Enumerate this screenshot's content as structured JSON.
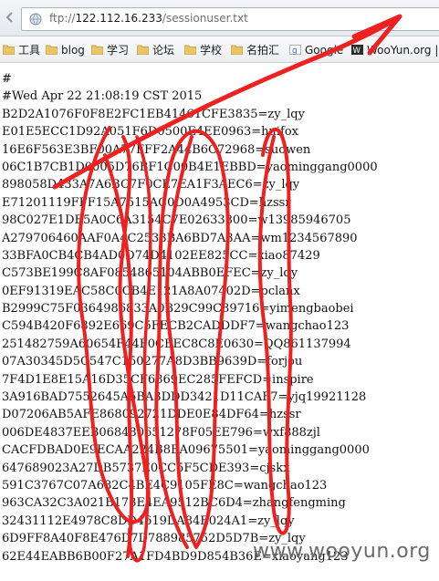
{
  "address_bar": {
    "url_prefix": "ftp://",
    "url_host": "122.112.16.233",
    "url_path": "/sessionuser.txt"
  },
  "bookmarks": [
    {
      "label": "工具",
      "icon": "folder-icon"
    },
    {
      "label": "blog",
      "icon": "folder-icon"
    },
    {
      "label": "学习",
      "icon": "folder-icon"
    },
    {
      "label": "论坛",
      "icon": "folder-icon"
    },
    {
      "label": "学校",
      "icon": "folder-icon"
    },
    {
      "label": "名拍汇",
      "icon": "folder-icon"
    },
    {
      "label": "Google",
      "icon": "google-icon"
    },
    {
      "label": "WooYun.org |",
      "icon": "wooyun-icon"
    }
  ],
  "file_lines": [
    "#",
    "#Wed Apr 22 21:08:19 CST 2015",
    "B2D2A1076F0F8E2FC1EB41461CFE3835=zy_lqy",
    "E01E5ECC1D92A051F6D0500E4EE0963=huifox",
    "16E6F563E3BF00A77FFF2A44B6C72968=suowen",
    "06C1B7CB1D0005D76BF1C00B4E1EBBD=yaominggang0000",
    "898058D433A7A6BC7F0CE7EA1F3AEC6=zy_lqy",
    "E71201119FFF15A7515AC0D0A4953CD=hzssr",
    "98C027E1DE5A0C6A3154C7E02633800=w13985946705",
    "A279706460AAF0A4C2533BA6BD7A3AA=wm1234567890",
    "33BFA0CB4CB4AD0D74D4102EE825CC=xiao87429",
    "C573BE199C8AF0854865104ABB0EFEC=zy_lqy",
    "0EF91319EAC58C0CB4E121A8A07402D=pclanx",
    "B2999C75F0364986833A0B29C99C89716=yimengbaobei",
    "C594B420F6892E669C5FECB2CADDDF7=wangchao123",
    "251482759A60654F44F0CBEC8C8E0630=QQ861137994",
    "07A30345D5C547C150277A8D3BB9639D=forjou",
    "7F4D1E8E15A16D35CF6869EC285FEFCD=inspire",
    "3A916BAD7552645A5BA3DDD3421D11CAF7=yjq19921128",
    "D07206AB5AFE868092721DDE0E84DF64=hzssr",
    "006DE4837EEB068480651278F05EE796=wxf888zjl",
    "CACFDBAD0E9ECAA224B8EA09675501=yaominggang0000",
    "647689023A27DB5737E0CC5F5CDE393=cjskx",
    "591C3767C07A682C4BE4C9105FE8C=wangchao123",
    "963CA32C3A021B173E4EA9512BC6D4=zhangfengming",
    "32431112E4978C8DD4619DA84E024A1=zy_lqy",
    "6D9FF8A40F8E476D7D788985752D5D7B=zy_lqy",
    "62E44EABB6B00F27A1FD4BD9D854B36E=xiaoyang123"
  ],
  "watermark": "www.wooyun.org"
}
